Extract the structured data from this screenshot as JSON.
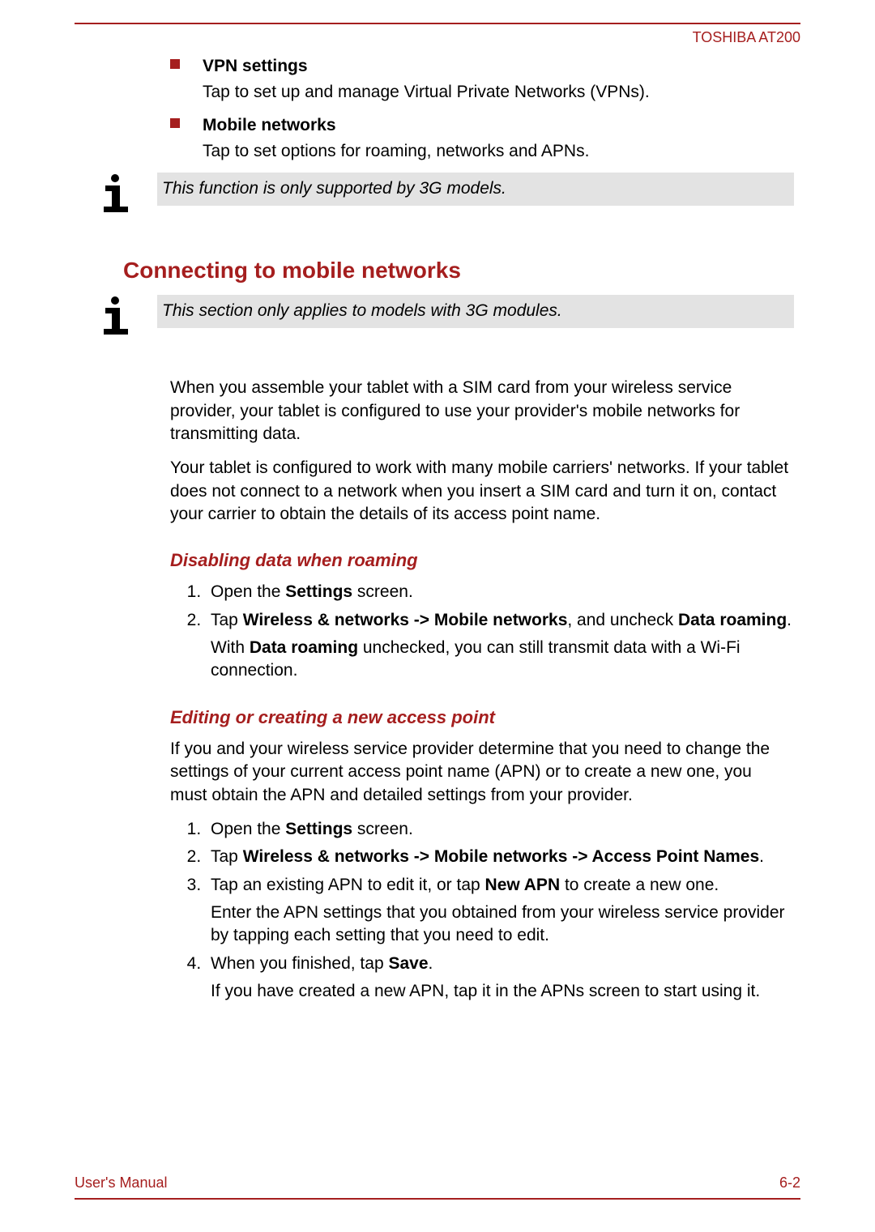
{
  "header": {
    "product": "TOSHIBA AT200"
  },
  "top_bullets": [
    {
      "label": "VPN settings",
      "desc": "Tap to set up and manage Virtual Private Networks (VPNs)."
    },
    {
      "label": "Mobile networks",
      "desc": "Tap to set options for roaming, networks and APNs."
    }
  ],
  "note1": "This function is only supported by 3G models.",
  "section_heading": "Connecting to mobile networks",
  "note2": "This section only applies to models with 3G modules.",
  "paras": [
    "When you assemble your tablet with a SIM card from your wireless service provider, your tablet is configured to use your provider's mobile networks for transmitting data.",
    "Your tablet is configured to work with many mobile carriers' networks. If your tablet does not connect to a network when you insert a SIM card and turn it on, contact your carrier to obtain the details of its access point name."
  ],
  "sub1_heading": "Disabling data when roaming",
  "sub1_steps": {
    "s1a": "Open the ",
    "s1b": "Settings",
    "s1c": " screen.",
    "s2a": "Tap ",
    "s2b": "Wireless & networks -> Mobile networks",
    "s2c": ", and uncheck ",
    "s2d": "Data roaming",
    "s2e": ".",
    "s2f_a": "With ",
    "s2f_b": "Data roaming",
    "s2f_c": " unchecked, you can still transmit data with a Wi-Fi connection."
  },
  "sub2_heading": "Editing or creating a new access point",
  "sub2_intro": "If you and your wireless service provider determine that you need to change the settings of your current access point name (APN) or to create a new one, you must obtain the APN and detailed settings from your provider.",
  "sub2_steps": {
    "s1a": "Open the ",
    "s1b": "Settings",
    "s1c": " screen.",
    "s2a": "Tap ",
    "s2b": "Wireless & networks -> Mobile networks -> Access Point Names",
    "s2c": ".",
    "s3a": "Tap an existing APN to edit it, or tap ",
    "s3b": "New APN",
    "s3c": " to create a new one.",
    "s3d": "Enter the APN settings that you obtained from your wireless service provider by tapping each setting that you need to edit.",
    "s4a": "When you finished, tap ",
    "s4b": "Save",
    "s4c": ".",
    "s4d": "If you have created a new APN, tap it in the APNs screen to start using it."
  },
  "footer": {
    "left": "User's Manual",
    "right": "6-2"
  }
}
